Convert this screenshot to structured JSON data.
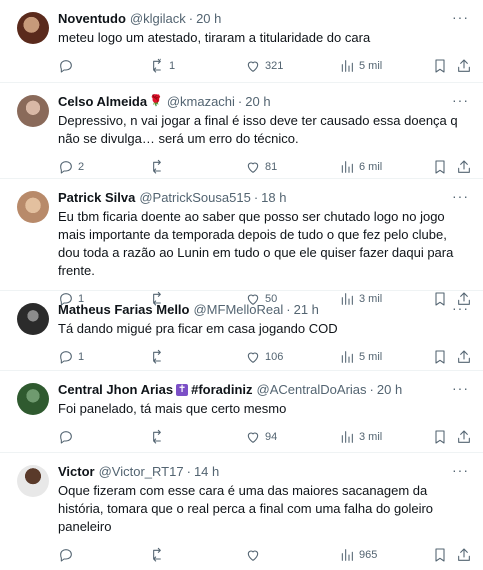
{
  "tweets": [
    {
      "name": "Noventudo",
      "handle": "@klgilack",
      "time": "20 h",
      "text": "meteu logo um atestado, tiraram a titularidade do cara",
      "replies": "",
      "retweets": "1",
      "likes": "321",
      "views": "5 mil",
      "avatar_color": "#5a2a1c"
    },
    {
      "name": "Celso Almeida",
      "name_emoji": "🌹",
      "handle": "@kmazachi",
      "time": "20 h",
      "text": "Depressivo, n vai jogar a final é isso deve ter causado essa doença q não se divulga… será um erro do técnico.",
      "replies": "2",
      "retweets": "",
      "likes": "81",
      "views": "6 mil",
      "avatar_color": "#8a6a5a"
    },
    {
      "name": "Patrick Silva",
      "handle": "@PatrickSousa515",
      "time": "18 h",
      "text": "Eu tbm ficaria doente ao saber que posso ser chutado logo no jogo mais importante da temporada depois de tudo o que fez pelo clube, dou toda a razão ao Lunin em tudo o que ele quiser fazer daqui para frente.",
      "replies": "1",
      "retweets": "",
      "likes": "50",
      "views": "3 mil",
      "avatar_color": "#b88a6a"
    },
    {
      "name": "Matheus Farias Mello",
      "handle": "@MFMelloReal",
      "time": "21 h",
      "text": "Tá dando migué pra ficar em casa jogando COD",
      "replies": "1",
      "retweets": "",
      "likes": "106",
      "views": "5 mil",
      "avatar_color": "#2b2b2b"
    },
    {
      "name": "Central Jhon Arias",
      "name_emoji": "✝",
      "name_tag": "#foradiniz",
      "handle": "@ACentralDoArias",
      "time": "20 h",
      "text": "Foi panelado, tá mais que certo mesmo",
      "replies": "",
      "retweets": "",
      "likes": "94",
      "views": "3 mil",
      "avatar_color": "#2f5a2f"
    },
    {
      "name": "Victor",
      "handle": "@Victor_RT17",
      "time": "14 h",
      "text": "Oque fizeram com esse cara é uma das maiores sacanagem da história, tomara que o real perca a final com uma falha do  goleiro paneleiro",
      "replies": "",
      "retweets": "",
      "likes": "",
      "views": "965",
      "avatar_color": "#3a2a20"
    }
  ],
  "more_icon": "more-dots-icon",
  "separator": "·"
}
